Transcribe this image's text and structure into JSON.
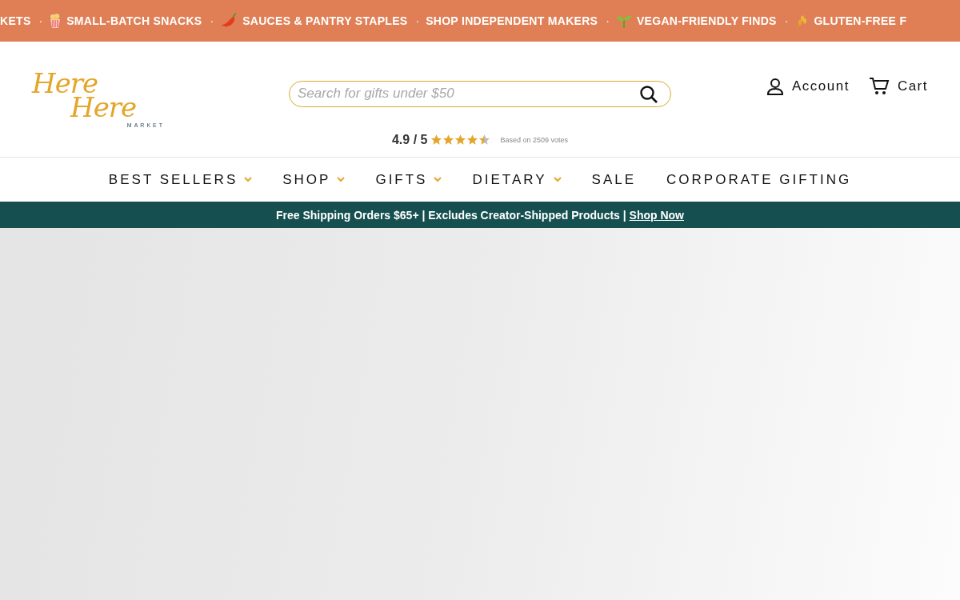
{
  "ticker": {
    "items": [
      {
        "kind": "plain",
        "text": "KETS",
        "separator": "·"
      },
      {
        "kind": "popcorn",
        "text": "SMALL-BATCH SNACKS",
        "separator": "·"
      },
      {
        "kind": "chili",
        "text": "SAUCES & PANTRY STAPLES",
        "separator": "·"
      },
      {
        "kind": "plain",
        "text": "SHOP INDEPENDENT MAKERS",
        "separator": "·"
      },
      {
        "kind": "sprout",
        "text": "VEGAN-FRIENDLY FINDS",
        "separator": "·"
      },
      {
        "kind": "wheat",
        "text": "GLUTEN-FREE F"
      }
    ]
  },
  "header": {
    "logo": {
      "script": "Here",
      "script_2": "Here",
      "subtitle": "MARKET"
    },
    "search": {
      "placeholder": "Search for gifts under $50"
    },
    "account": "Account",
    "cart": "Cart",
    "rating": {
      "score": "4.9 / 5",
      "stars": 4.5,
      "votes": "Based on 2509 votes"
    }
  },
  "nav": [
    {
      "label": "BEST SELLERS",
      "dropdown": true
    },
    {
      "label": "SHOP",
      "dropdown": true
    },
    {
      "label": "GIFTS",
      "dropdown": true
    },
    {
      "label": "DIETARY",
      "dropdown": true
    },
    {
      "label": "SALE",
      "dropdown": false
    },
    {
      "label": "CORPORATE GIFTING",
      "dropdown": false
    }
  ],
  "promo_bar": {
    "text": "Free Shipping Orders $65+ | Excludes Creator-Shipped Products |",
    "link": "Shop Now"
  }
}
